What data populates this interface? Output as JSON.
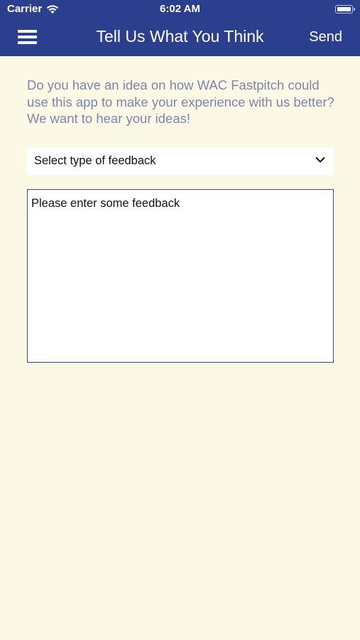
{
  "status_bar": {
    "carrier": "Carrier",
    "time": "6:02 AM"
  },
  "header": {
    "title": "Tell Us What You Think",
    "send_label": "Send",
    "menu_icon": "hamburger-menu-icon",
    "background_color": "#2b3f8e"
  },
  "main": {
    "intro_text": "Do you have an idea on how WAC Fastpitch could use this app to make your experience with us better? We want to hear your ideas!",
    "feedback_type": {
      "placeholder": "Select type of feedback"
    },
    "feedback_input": {
      "placeholder": "Please enter some feedback"
    },
    "background_color": "#fbf9e6"
  }
}
